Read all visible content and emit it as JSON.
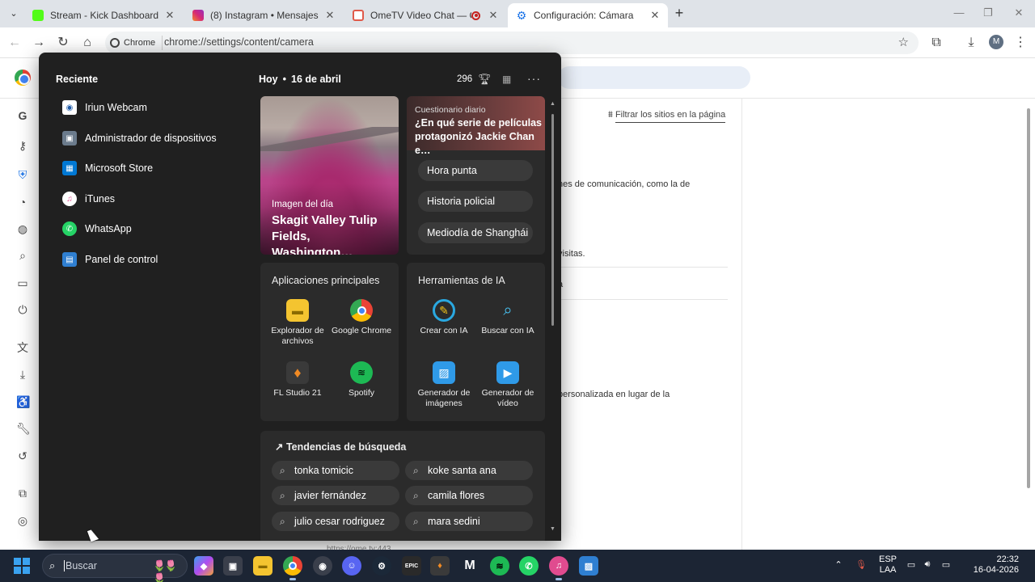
{
  "tabs": [
    {
      "title": "Stream - Kick Dashboard",
      "favicon_color": "#53fc18"
    },
    {
      "title": "(8) Instagram • Mensajes",
      "favicon_color": "#d62976"
    },
    {
      "title": "OmeTV Video Chat — Ome",
      "favicon_color": "#e05a4a"
    },
    {
      "title": "Configuración: Cámara",
      "favicon_color": "#1a73e8"
    }
  ],
  "toolbar": {
    "chip_label": "Chrome",
    "url": "chrome://settings/content/camera",
    "avatar_letter": "M"
  },
  "settings": {
    "filter_label": "Filtrar los sitios en la página",
    "text_1": "nes de comunicación, como la de",
    "text_2": "visitas.",
    "text_3": "a",
    "text_4": "personalizada en lugar de la",
    "bottom_url": "https://ome.tv:443"
  },
  "start": {
    "recent_title": "Reciente",
    "recent": [
      {
        "label": "Iriun Webcam",
        "icon": "webcam-icon",
        "color": "#1e5aa8"
      },
      {
        "label": "Administrador de dispositivos",
        "icon": "device-manager-icon",
        "color": "#6b7b8c"
      },
      {
        "label": "Microsoft Store",
        "icon": "store-icon",
        "color": "#0078d4"
      },
      {
        "label": "iTunes",
        "icon": "itunes-icon",
        "color": "#e04b8f"
      },
      {
        "label": "WhatsApp",
        "icon": "whatsapp-icon",
        "color": "#25d366"
      },
      {
        "label": "Panel de control",
        "icon": "control-panel-icon",
        "color": "#2f7fd1"
      }
    ],
    "today_label": "Hoy",
    "date": "16 de abril",
    "points": "296",
    "photo": {
      "subtitle": "Imagen del día",
      "title": "Skagit Valley Tulip Fields, Washington…"
    },
    "quiz": {
      "label": "Cuestionario diario",
      "question": "¿En qué serie de películas protagonizó Jackie Chan e…",
      "options": [
        "Hora punta",
        "Historia policial",
        "Mediodía de Shanghái"
      ]
    },
    "apps": {
      "title": "Aplicaciones principales",
      "items": [
        {
          "label": "Explorador de archivos",
          "icon": "file-explorer-icon",
          "color": "#f4c430"
        },
        {
          "label": "Google Chrome",
          "icon": "chrome-icon",
          "color": "#4285f4"
        },
        {
          "label": "FL Studio 21",
          "icon": "fl-studio-icon",
          "color": "#f08a24"
        },
        {
          "label": "Spotify",
          "icon": "spotify-icon",
          "color": "#1db954"
        }
      ]
    },
    "ai_tools": {
      "title": "Herramientas de IA",
      "items": [
        {
          "label": "Crear con IA",
          "icon": "create-ai-icon",
          "color": "#2aa8e0"
        },
        {
          "label": "Buscar con IA",
          "icon": "search-ai-icon",
          "color": "#49c2f2"
        },
        {
          "label": "Generador de imágenes",
          "icon": "image-generator-icon",
          "color": "#2f9ae8"
        },
        {
          "label": "Generador de vídeo",
          "icon": "video-generator-icon",
          "color": "#2f9ae8"
        }
      ]
    },
    "trends": {
      "title": "Tendencias de búsqueda",
      "items": [
        "tonka tomicic",
        "koke santa ana",
        "javier fernández",
        "camila flores",
        "julio cesar rodriguez",
        "mara sedini"
      ]
    }
  },
  "taskbar": {
    "search_placeholder": "Buscar",
    "language": "ESP",
    "layout": "LAA",
    "time": "22:32",
    "date": "16-04-2026"
  }
}
